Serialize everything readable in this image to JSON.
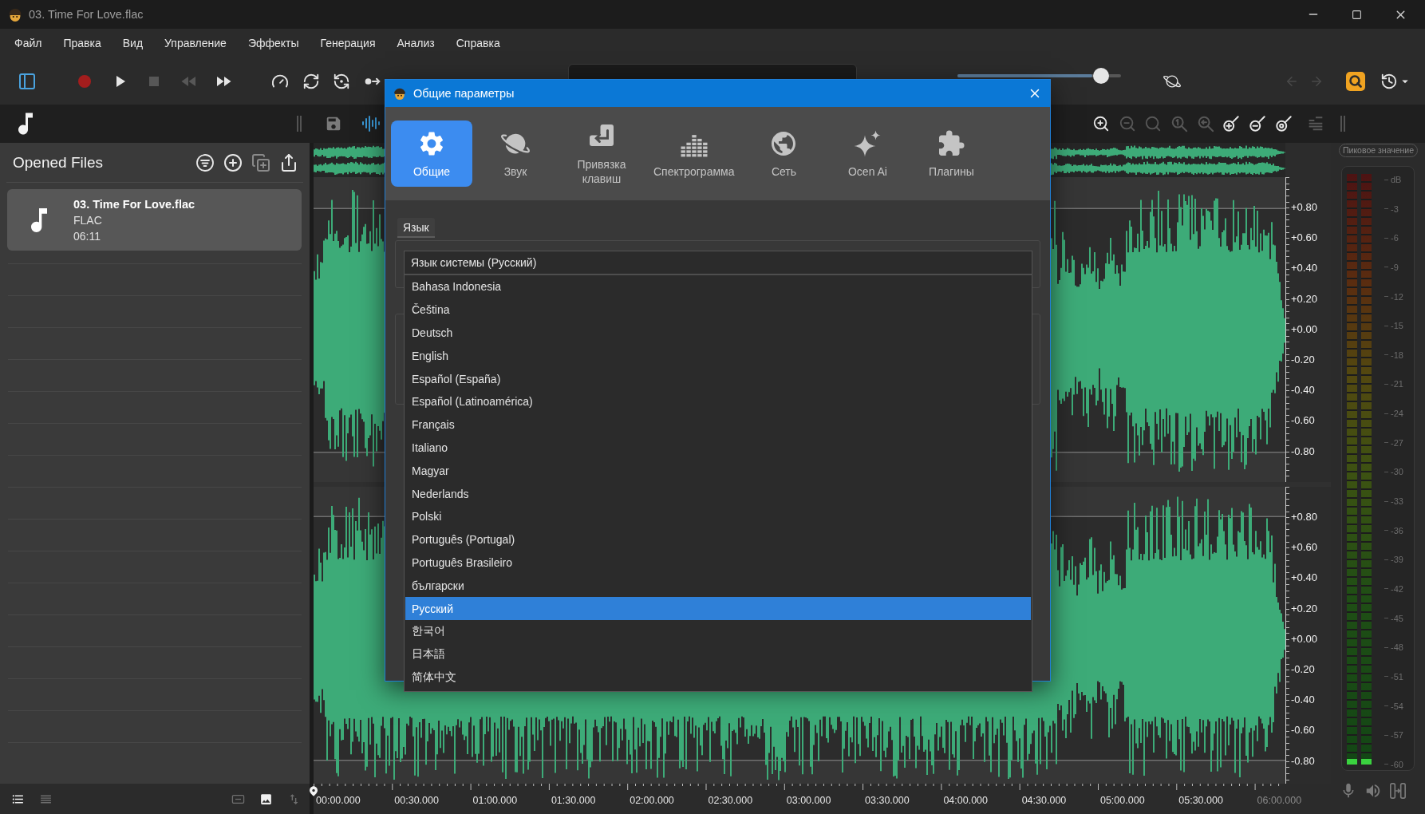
{
  "window": {
    "title": "03. Time For Love.flac"
  },
  "menu": [
    "Файл",
    "Правка",
    "Вид",
    "Управление",
    "Эффекты",
    "Генерация",
    "Анализ",
    "Справка"
  ],
  "toolbar": {
    "sidebar_toggle": {
      "on": true
    },
    "transport": [
      {
        "disabled": false
      },
      {
        "disabled": false
      },
      {
        "disabled": true
      },
      {
        "disabled": true
      },
      {
        "disabled": false
      }
    ],
    "playback_tools": [
      {
        "disabled": false
      },
      {
        "disabled": false
      },
      {
        "disabled": false
      },
      {
        "disabled": false
      }
    ],
    "volume": {
      "level": 0.88
    },
    "history": [
      {
        "disabled": true
      },
      {
        "disabled": true
      }
    ]
  },
  "editor_bar": {
    "waveform_view": {
      "on": true
    },
    "zoom_tools": [
      {
        "disabled": false
      },
      {
        "disabled": true
      },
      {
        "disabled": true
      },
      {
        "disabled": true
      },
      {
        "disabled": true
      },
      {
        "disabled": false
      },
      {
        "disabled": false
      },
      {
        "disabled": false
      },
      {
        "disabled": true
      }
    ]
  },
  "opened_files": {
    "title": "Opened Files",
    "actions": [
      {
        "disabled": false
      },
      {
        "disabled": false
      },
      {
        "disabled": true
      },
      {
        "disabled": false
      }
    ],
    "files": [
      {
        "name": "03. Time For Love.flac",
        "format": "FLAC",
        "duration": "06:11",
        "selected": true
      }
    ],
    "view_modes": [
      {
        "selected": true
      },
      {
        "selected": false
      }
    ],
    "bottom_actions": [
      {
        "disabled": true
      },
      {
        "disabled": false
      },
      {
        "disabled": true
      }
    ]
  },
  "waveform": {
    "channels": [
      {
        "axis_labels": [
          "+0.80",
          "+0.60",
          "+0.40",
          "+0.20",
          "+0.00",
          "-0.20",
          "-0.40",
          "-0.60",
          "-0.80"
        ]
      },
      {
        "axis_labels": [
          "+0.80",
          "+0.60",
          "+0.40",
          "+0.20",
          "+0.00",
          "-0.20",
          "-0.40",
          "-0.60",
          "-0.80"
        ]
      }
    ],
    "timeline": [
      {
        "label": "00:00.000",
        "muted": false
      },
      {
        "label": "00:30.000",
        "muted": false
      },
      {
        "label": "01:00.000",
        "muted": false
      },
      {
        "label": "01:30.000",
        "muted": false
      },
      {
        "label": "02:00.000",
        "muted": false
      },
      {
        "label": "02:30.000",
        "muted": false
      },
      {
        "label": "03:00.000",
        "muted": false
      },
      {
        "label": "03:30.000",
        "muted": false
      },
      {
        "label": "04:00.000",
        "muted": false
      },
      {
        "label": "04:30.000",
        "muted": false
      },
      {
        "label": "05:00.000",
        "muted": false
      },
      {
        "label": "05:30.000",
        "muted": false
      },
      {
        "label": "06:00.000",
        "muted": true
      }
    ]
  },
  "meter": {
    "peak_button": "Пиковое значение",
    "scale": [
      "dB",
      "-3",
      "-6",
      "-9",
      "-12",
      "-15",
      "-18",
      "-21",
      "-24",
      "-27",
      "-30",
      "-33",
      "-36",
      "-39",
      "-42",
      "-45",
      "-48",
      "-51",
      "-54",
      "-57",
      "-60"
    ],
    "channels": [
      {
        "level": 0.01
      },
      {
        "level": 0.01
      }
    ]
  },
  "dialog": {
    "title": "Общие параметры",
    "tabs": [
      {
        "label": "Общие",
        "selected": true
      },
      {
        "label": "Звук",
        "selected": false
      },
      {
        "label": "Привязка клавиш",
        "selected": false
      },
      {
        "label": "Спектрограмма",
        "selected": false
      },
      {
        "label": "Сеть",
        "selected": false
      },
      {
        "label": "Ocen Ai",
        "selected": false
      },
      {
        "label": "Плагины",
        "selected": false
      }
    ],
    "section": "Язык",
    "language": {
      "value": "Язык системы (Русский)",
      "expanded": true,
      "options": [
        {
          "label": "Bahasa Indonesia",
          "selected": false
        },
        {
          "label": "Čeština",
          "selected": false
        },
        {
          "label": "Deutsch",
          "selected": false
        },
        {
          "label": "English",
          "selected": false
        },
        {
          "label": "Español (España)",
          "selected": false
        },
        {
          "label": "Español (Latinoamérica)",
          "selected": false
        },
        {
          "label": "Français",
          "selected": false
        },
        {
          "label": "Italiano",
          "selected": false
        },
        {
          "label": "Magyar",
          "selected": false
        },
        {
          "label": "Nederlands",
          "selected": false
        },
        {
          "label": "Polski",
          "selected": false
        },
        {
          "label": "Português (Portugal)",
          "selected": false
        },
        {
          "label": "Português Brasileiro",
          "selected": false
        },
        {
          "label": "български",
          "selected": false
        },
        {
          "label": "Русский",
          "selected": true
        },
        {
          "label": "한국어",
          "selected": false
        },
        {
          "label": "日本語",
          "selected": false
        },
        {
          "label": "简体中文",
          "selected": false
        }
      ]
    }
  }
}
